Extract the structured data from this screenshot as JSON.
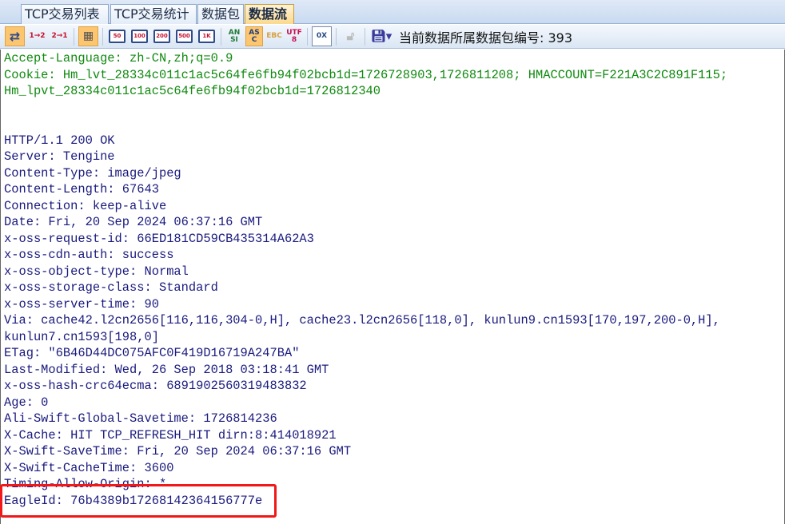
{
  "tabs": [
    "TCP交易列表",
    "TCP交易统计",
    "数据包",
    "数据流"
  ],
  "active_tab": "数据流",
  "toolbar": {
    "buttons": [
      {
        "icon": "bidirectional-arrows-icon",
        "active": true
      },
      {
        "icon": "direction-1-to-2-icon",
        "label": "1→2"
      },
      {
        "icon": "direction-2-to-1-icon",
        "label": "2→1"
      },
      {
        "icon": "grid-view-icon",
        "active": true
      },
      {
        "icon": "limit-50-icon",
        "label": "50"
      },
      {
        "icon": "limit-100-icon",
        "label": "100"
      },
      {
        "icon": "limit-200-icon",
        "label": "200"
      },
      {
        "icon": "limit-500-icon",
        "label": "500"
      },
      {
        "icon": "limit-1k-icon",
        "label": "1K"
      },
      {
        "icon": "ansi-encoding-icon",
        "label": "ANSI"
      },
      {
        "icon": "ascii-encoding-icon",
        "label": "ASC",
        "active": true
      },
      {
        "icon": "ebcdic-encoding-icon",
        "label": "EBC"
      },
      {
        "icon": "utf8-encoding-icon",
        "label": "UTF8"
      },
      {
        "icon": "hex-view-icon",
        "label": "0X"
      },
      {
        "icon": "unlock-icon",
        "disabled": true
      },
      {
        "icon": "save-edit-icon"
      }
    ],
    "packet_label": "当前数据所属数据包编号: 393"
  },
  "colors": {
    "request_text": "#108a10",
    "response_text": "#1a1a7e",
    "highlight_box": "#f01818",
    "active_tab": "#fbd98e"
  },
  "request_lines": [
    "Accept-Language: zh-CN,zh;q=0.9",
    "Cookie: Hm_lvt_28334c011c1ac5c64fe6fb94f02bcb1d=1726728903,1726811208; HMACCOUNT=F221A3C2C891F115;",
    "Hm_lpvt_28334c011c1ac5c64fe6fb94f02bcb1d=1726812340",
    "",
    ""
  ],
  "response_lines": [
    "HTTP/1.1 200 OK",
    "Server: Tengine",
    "Content-Type: image/jpeg",
    "Content-Length: 67643",
    "Connection: keep-alive",
    "Date: Fri, 20 Sep 2024 06:37:16 GMT",
    "x-oss-request-id: 66ED181CD59CB435314A62A3",
    "x-oss-cdn-auth: success",
    "x-oss-object-type: Normal",
    "x-oss-storage-class: Standard",
    "x-oss-server-time: 90",
    "Via: cache42.l2cn2656[116,116,304-0,H], cache23.l2cn2656[118,0], kunlun9.cn1593[170,197,200-0,H],",
    "kunlun7.cn1593[198,0]",
    "ETag: \"6B46D44DC075AFC0F419D16719A247BA\"",
    "Last-Modified: Wed, 26 Sep 2018 03:18:41 GMT",
    "x-oss-hash-crc64ecma: 6891902560319483832",
    "Age: 0",
    "Ali-Swift-Global-Savetime: 1726814236",
    "X-Cache: HIT TCP_REFRESH_HIT dirn:8:414018921",
    "X-Swift-SaveTime: Fri, 20 Sep 2024 06:37:16 GMT",
    "X-Swift-CacheTime: 3600",
    "Timing-Allow-Origin: *",
    "EagleId: 76b4389b17268142364156777e"
  ]
}
